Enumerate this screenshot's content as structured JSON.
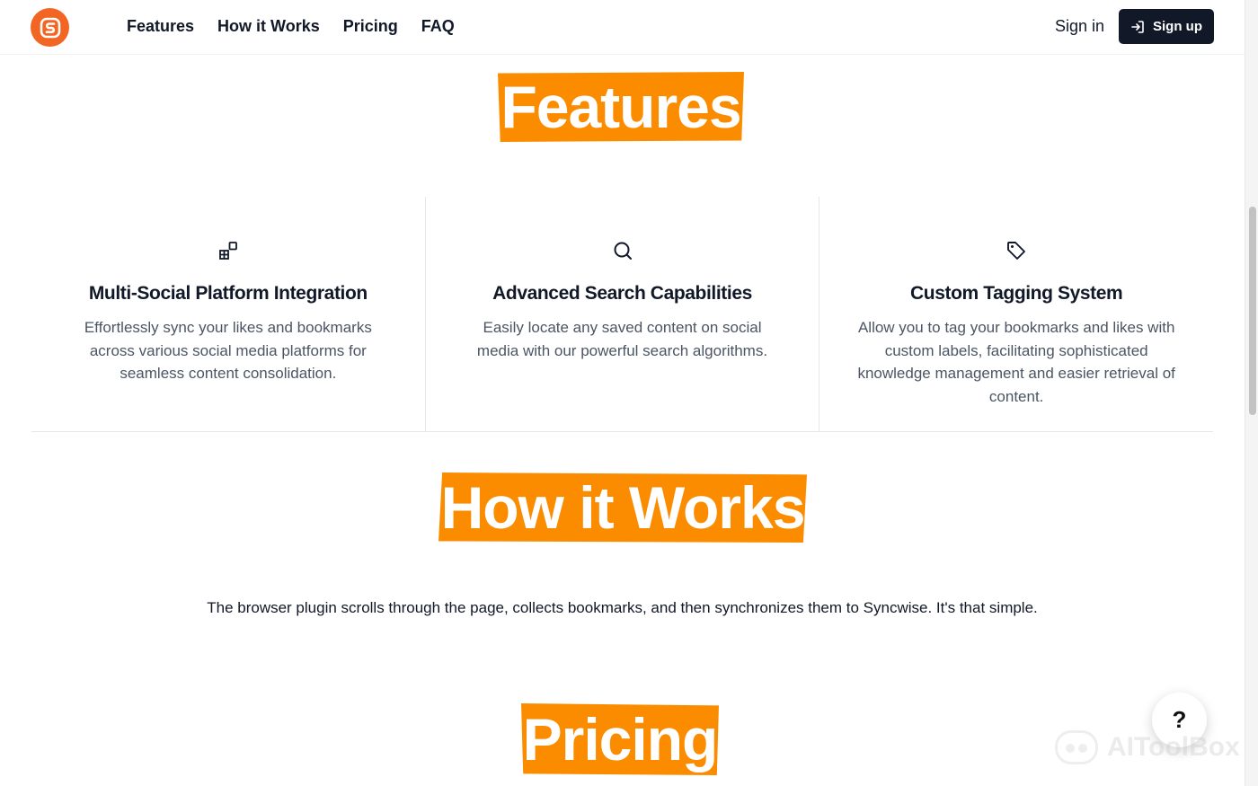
{
  "header": {
    "logo_icon": "s-logo-icon",
    "brand_color": "#f26522",
    "nav": [
      "Features",
      "How it Works",
      "Pricing",
      "FAQ"
    ],
    "sign_in": "Sign in",
    "sign_up": "Sign up",
    "sign_up_icon": "sign-in-arrow-icon"
  },
  "sections": {
    "features_title": "Features",
    "how_title": "How it Works",
    "pricing_title": "Pricing",
    "highlight_color": "#fb8c00"
  },
  "features": [
    {
      "icon": "blocks-icon",
      "title": "Multi-Social Platform Integration",
      "description": "Effortlessly sync your likes and bookmarks across various social media platforms for seamless content consolidation."
    },
    {
      "icon": "search-icon",
      "title": "Advanced Search Capabilities",
      "description": "Easily locate any saved content on social media with our powerful search algorithms."
    },
    {
      "icon": "tag-icon",
      "title": "Custom Tagging System",
      "description": "Allow you to tag your bookmarks and likes with custom labels, facilitating sophisticated knowledge management and easier retrieval of content."
    }
  ],
  "how_it_works": {
    "description": "The browser plugin scrolls through the page, collects bookmarks, and then synchronizes them to Syncwise. It's that simple."
  },
  "help_button": {
    "label": "?"
  },
  "watermark": {
    "text": "AIToolBox"
  }
}
